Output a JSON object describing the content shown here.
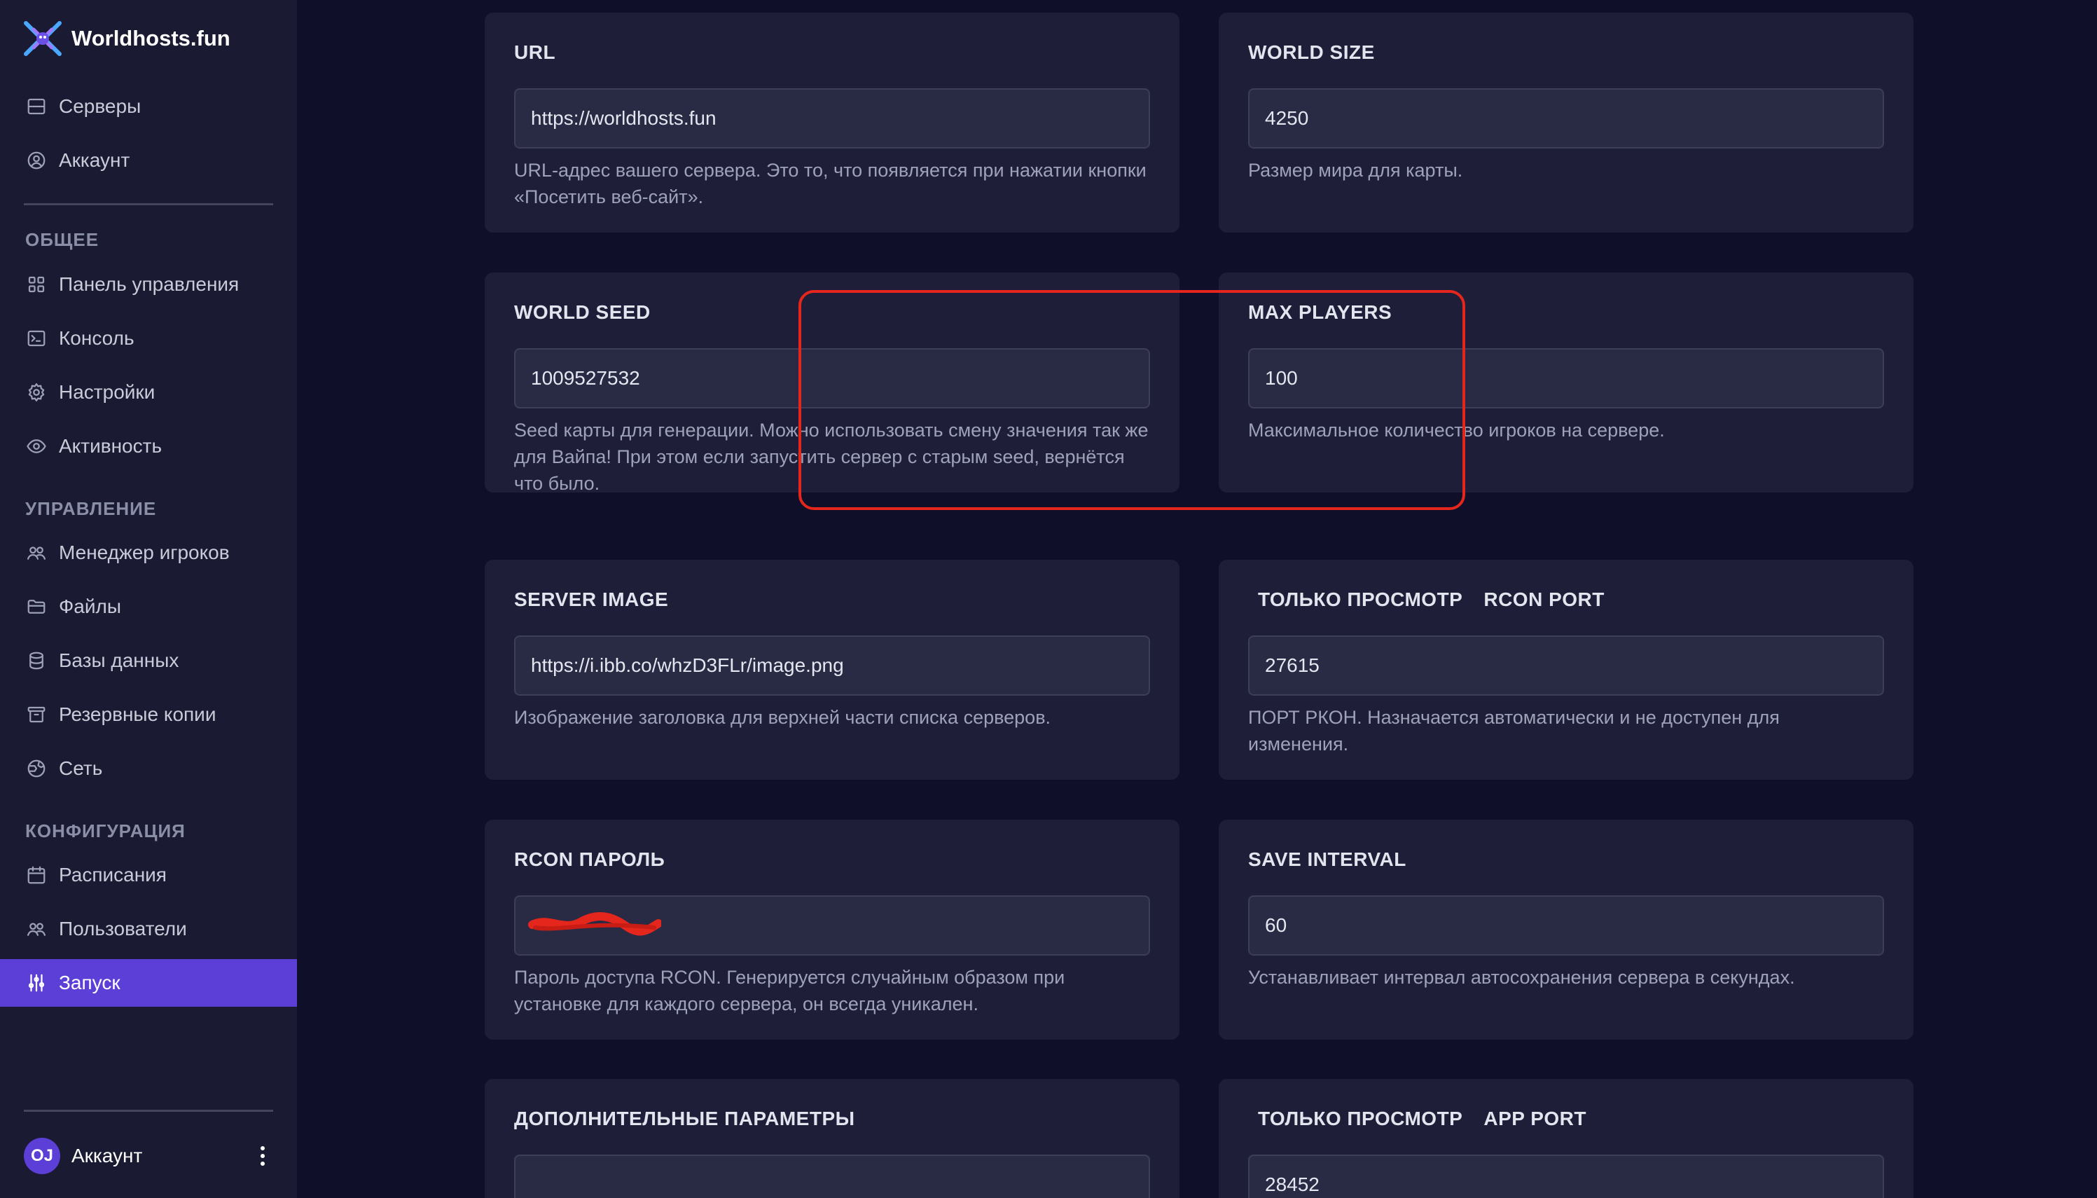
{
  "brand": {
    "name": "Worldhosts.fun"
  },
  "sidebar": {
    "top_items": [
      {
        "label": "Серверы",
        "icon": "server-icon"
      },
      {
        "label": "Аккаунт",
        "icon": "user-circle-icon"
      }
    ],
    "sections": [
      {
        "title": "ОБЩЕЕ",
        "items": [
          {
            "label": "Панель управления",
            "icon": "dashboard-icon"
          },
          {
            "label": "Консоль",
            "icon": "terminal-icon"
          },
          {
            "label": "Настройки",
            "icon": "gear-icon"
          },
          {
            "label": "Активность",
            "icon": "eye-icon"
          }
        ]
      },
      {
        "title": "УПРАВЛЕНИЕ",
        "items": [
          {
            "label": "Менеджер игроков",
            "icon": "users-icon"
          },
          {
            "label": "Файлы",
            "icon": "folder-icon"
          },
          {
            "label": "Базы данных",
            "icon": "database-icon"
          },
          {
            "label": "Резервные копии",
            "icon": "archive-icon"
          },
          {
            "label": "Сеть",
            "icon": "globe-icon"
          }
        ]
      },
      {
        "title": "КОНФИГУРАЦИЯ",
        "items": [
          {
            "label": "Расписания",
            "icon": "calendar-icon"
          },
          {
            "label": "Пользователи",
            "icon": "users-icon"
          },
          {
            "label": "Запуск",
            "icon": "sliders-icon",
            "active": true
          }
        ]
      }
    ],
    "account": {
      "initials": "OJ",
      "label": "Аккаунт"
    }
  },
  "variables": {
    "url": {
      "label": "URL",
      "value": "https://worldhosts.fun",
      "help": "URL-адрес вашего сервера. Это то, что появляется при нажатии кнопки «Посетить веб-сайт»."
    },
    "world_size": {
      "label": "WORLD SIZE",
      "value": "4250",
      "help": "Размер мира для карты."
    },
    "world_seed": {
      "label": "WORLD SEED",
      "value": "1009527532",
      "help": "Seed карты для генерации. Можно использовать смену значения так же для Вайпа! При этом если запустить сервер с старым seed, вернётся что было."
    },
    "max_players": {
      "label": "MAX PLAYERS",
      "value": "100",
      "help": "Максимальное количество игроков на сервере."
    },
    "server_image": {
      "label": "SERVER IMAGE",
      "value": "https://i.ibb.co/whzD3FLr/image.png",
      "help": "Изображение заголовка для верхней части списка серверов."
    },
    "rcon_port": {
      "readonly_label": "ТОЛЬКО ПРОСМОТР",
      "label": "RCON PORT",
      "value": "27615",
      "help": "ПОРТ РКОН. Назначается автоматически и не доступен для изменения."
    },
    "rcon_password": {
      "label": "RCON ПАРОЛЬ",
      "help": "Пароль доступа RCON. Генерируется случайным образом при установке для каждого сервера, он всегда уникален."
    },
    "save_interval": {
      "label": "SAVE INTERVAL",
      "value": "60",
      "help": "Устанавливает интервал автосохранения сервера в секундах."
    },
    "extra_params": {
      "label": "ДОПОЛНИТЕЛЬНЫЕ ПАРАМЕТРЫ",
      "value": ""
    },
    "app_port": {
      "readonly_label": "ТОЛЬКО ПРОСМОТР",
      "label": "APP PORT",
      "value": "28452"
    }
  },
  "colors": {
    "accent": "#5b3fd6",
    "highlight": "#e5261c",
    "background": "#0f0f2a",
    "sidebar": "#1a1a33",
    "card": "#1e1e39"
  }
}
